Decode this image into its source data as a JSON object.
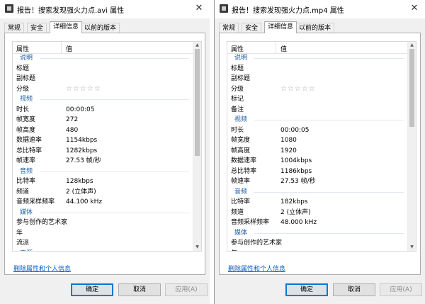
{
  "left": {
    "title": "报告！搜索发现强火力点.avi 属性",
    "tabs": [
      "常规",
      "安全",
      "详细信息",
      "以前的版本"
    ],
    "active_tab": 2,
    "columns": {
      "name": "属性",
      "value": "值"
    },
    "rows": [
      {
        "type": "section",
        "k": "说明"
      },
      {
        "k": "标题",
        "v": ""
      },
      {
        "k": "副标题",
        "v": ""
      },
      {
        "k": "分级",
        "stars": "☆☆☆☆☆"
      },
      {
        "type": "section",
        "k": "视频"
      },
      {
        "k": "时长",
        "v": "00:00:05"
      },
      {
        "k": "帧宽度",
        "v": "272"
      },
      {
        "k": "帧高度",
        "v": "480"
      },
      {
        "k": "数据速率",
        "v": "1154kbps"
      },
      {
        "k": "总比特率",
        "v": "1282kbps"
      },
      {
        "k": "帧速率",
        "v": "27.53 帧/秒"
      },
      {
        "type": "section",
        "k": "音频"
      },
      {
        "k": "比特率",
        "v": "128kbps"
      },
      {
        "k": "频道",
        "v": "2 (立体声)"
      },
      {
        "k": "音频采样频率",
        "v": "44.100 kHz"
      },
      {
        "type": "section",
        "k": "媒体"
      },
      {
        "k": "参与创作的艺术家",
        "v": ""
      },
      {
        "k": "年",
        "v": ""
      },
      {
        "k": "流派",
        "v": ""
      },
      {
        "type": "section",
        "k": "来源"
      }
    ],
    "scroll_thumb": {
      "position": 0.0,
      "size": 0.55
    },
    "remove_link": "删除属性和个人信息",
    "buttons": {
      "ok": "确定",
      "cancel": "取消",
      "apply": "应用(A)"
    }
  },
  "right": {
    "title": "报告！搜索发现强火力点.mp4 属性",
    "tabs": [
      "常规",
      "安全",
      "详细信息",
      "以前的版本"
    ],
    "active_tab": 2,
    "columns": {
      "name": "属性",
      "value": "值"
    },
    "rows": [
      {
        "type": "section",
        "k": "说明"
      },
      {
        "k": "标题",
        "v": ""
      },
      {
        "k": "副标题",
        "v": ""
      },
      {
        "k": "分级",
        "stars": "☆☆☆☆☆"
      },
      {
        "k": "标记",
        "v": ""
      },
      {
        "k": "备注",
        "v": ""
      },
      {
        "type": "section",
        "k": "视频"
      },
      {
        "k": "时长",
        "v": "00:00:05"
      },
      {
        "k": "帧宽度",
        "v": "1080"
      },
      {
        "k": "帧高度",
        "v": "1920"
      },
      {
        "k": "数据速率",
        "v": "1004kbps"
      },
      {
        "k": "总比特率",
        "v": "1186kbps"
      },
      {
        "k": "帧速率",
        "v": "27.53 帧/秒"
      },
      {
        "type": "section",
        "k": "音频"
      },
      {
        "k": "比特率",
        "v": "182kbps"
      },
      {
        "k": "频道",
        "v": "2 (立体声)"
      },
      {
        "k": "音频采样频率",
        "v": "48.000 kHz"
      },
      {
        "type": "section",
        "k": "媒体"
      },
      {
        "k": "参与创作的艺术家",
        "v": ""
      },
      {
        "k": "年",
        "v": ""
      }
    ],
    "scroll_thumb": {
      "position": 0.0,
      "size": 0.4
    },
    "remove_link": "删除属性和个人信息",
    "buttons": {
      "ok": "确定",
      "cancel": "取消",
      "apply": "应用(A)"
    }
  }
}
